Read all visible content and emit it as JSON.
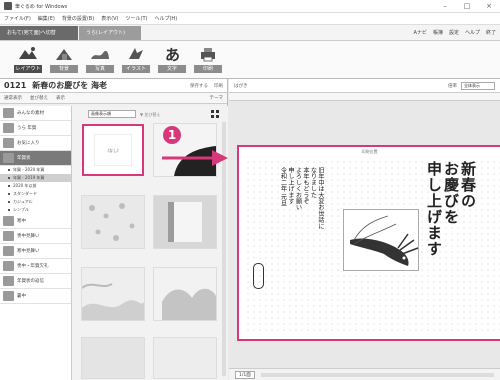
{
  "window": {
    "title": "筆ぐるめ for Windows",
    "controls": [
      "–",
      "□",
      "×"
    ]
  },
  "menubar": [
    "ファイル(F)",
    "編集(E)",
    "背景の設置(B)",
    "表示(V)",
    "ツール(T)",
    "ヘルプ(H)",
    "ヘルプ(H)"
  ],
  "modetabs": [
    "おもて(宛て面)へ切替",
    "うら(レイアウト)"
  ],
  "rightlinks": [
    "Aナビ",
    "帳簿",
    "設定",
    "ヘルプ",
    "終了"
  ],
  "tools": [
    {
      "label": "レイアウト",
      "icon": "layout-icon"
    },
    {
      "label": "背景",
      "icon": "background-icon"
    },
    {
      "label": "写真",
      "icon": "photo-icon"
    },
    {
      "label": "イラスト",
      "icon": "illustration-icon"
    },
    {
      "label": "文字",
      "icon": "text-icon"
    },
    {
      "label": "印刷",
      "icon": "print-icon"
    }
  ],
  "document": {
    "code": "0121",
    "name": "新春のお慶びを 海老",
    "buttons": [
      "保存する",
      "印刷"
    ]
  },
  "subbar": {
    "left": [
      "通常表示",
      "並び替え",
      "表示"
    ],
    "right": "テーマ"
  },
  "categories": [
    {
      "label": "みんなの素材"
    },
    {
      "label": "うら 年賀"
    },
    {
      "label": "お気に入り"
    },
    {
      "label": "年賀状",
      "selected": true
    }
  ],
  "subcategories": [
    {
      "label": "年賀 - 2020 年賀"
    },
    {
      "label": "年賀 - 2019 年賀",
      "selected": true
    },
    {
      "label": "2020 年以前"
    },
    {
      "label": "スタンダード"
    },
    {
      "label": "カジュアル"
    },
    {
      "label": "シンプル"
    }
  ],
  "categories2": [
    "寒中",
    "喪中見舞い",
    "寒中見舞い",
    "喪中・年賀欠礼",
    "年賀状の返信",
    "暑中"
  ],
  "filter": {
    "value": "画像表示順",
    "hint": "▼ 並び替え"
  },
  "thumbs": {
    "blank_label": "(なし)"
  },
  "badge": "1",
  "preview": {
    "title": "はがき",
    "zoom_label": "倍率",
    "zoom_value": "全体表示",
    "address_label": "印刷位置",
    "body_text": "旧年中は大変お世話に\nなりました\n本年もどうぞ\nよろしくお願い\n申し上げます\n令和二年 元旦",
    "greeting": "新春の\nお慶びを\n申し上げます",
    "page": "1/1面"
  },
  "colors": {
    "accent": "#d6387a"
  }
}
